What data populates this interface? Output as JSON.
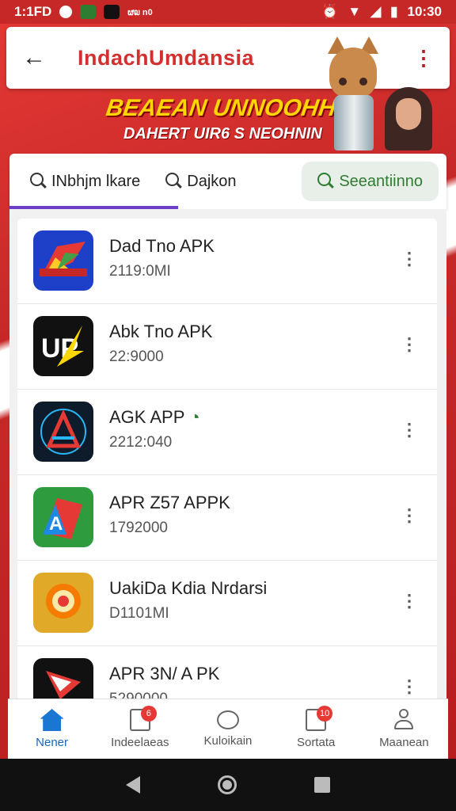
{
  "status_bar": {
    "time_left": "1:1FD",
    "small_text": "ຜ໙ n0",
    "time_right": "10:30"
  },
  "app_bar": {
    "title": "IndachUmdansia"
  },
  "promo": {
    "title": "BEAEAN UNNOOHHIR!",
    "subtitle": "DAHERT UIR6 S NEOHNIN"
  },
  "tabs": [
    {
      "label": "INbhjm lkare"
    },
    {
      "label": "Dajkon"
    },
    {
      "label": "Seeantiinno"
    }
  ],
  "apps": [
    {
      "title": "Dad Tno APK",
      "size": "2119:0MI"
    },
    {
      "title": "Abk Tno APK",
      "size": "22:9000"
    },
    {
      "title": "AGK APP",
      "size": "2212:040",
      "badge": "◔"
    },
    {
      "title": "APR Z57 APPK",
      "size": "1792000"
    },
    {
      "title": "UakiDa Kdia Nrdarsi",
      "size": "D1101MI"
    },
    {
      "title": "APR 3N/ A PK",
      "size": "5290000"
    }
  ],
  "bottom_nav": [
    {
      "label": "Nener",
      "icon": "home-icon"
    },
    {
      "label": "Indeelaeas",
      "icon": "document-icon",
      "badge": "6"
    },
    {
      "label": "Kuloikain",
      "icon": "chat-icon"
    },
    {
      "label": "Sortata",
      "icon": "box-icon",
      "badge": "10"
    },
    {
      "label": "Maanean",
      "icon": "user-icon"
    }
  ],
  "colors": {
    "brand_red": "#d32f2f",
    "tab_underline": "#6a3fc6",
    "chip_green": "#2e7d32",
    "nav_active": "#1565c0"
  }
}
